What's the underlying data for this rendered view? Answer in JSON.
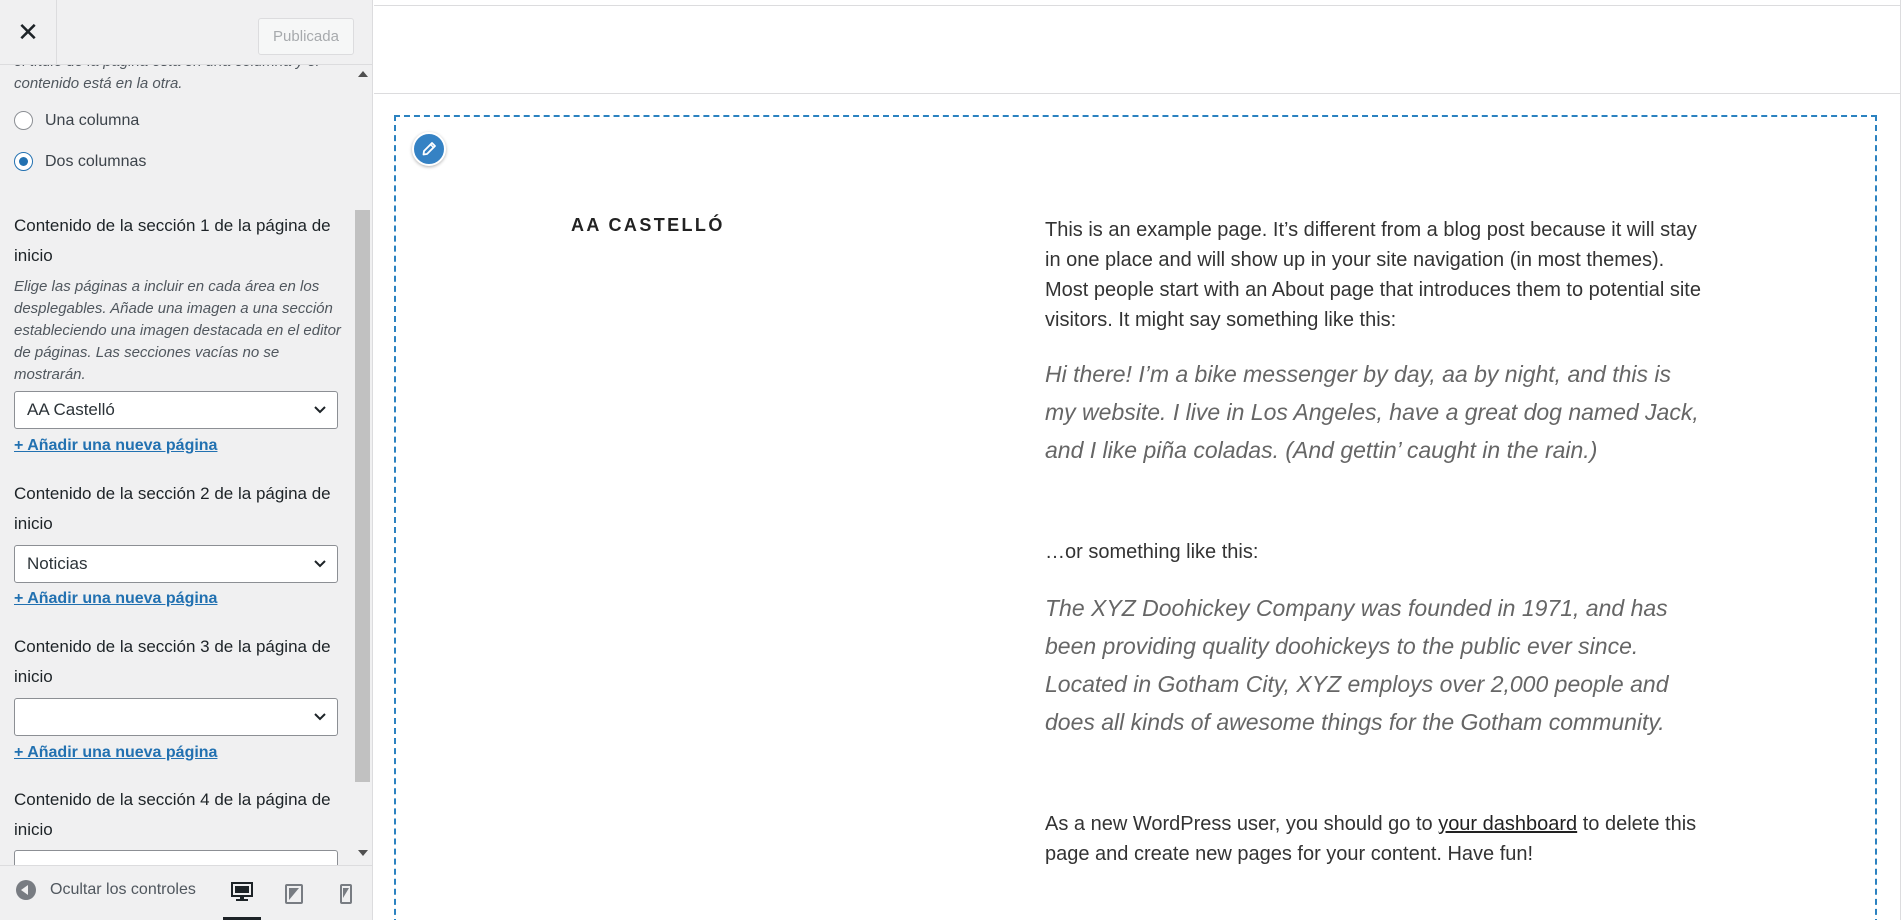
{
  "header": {
    "close_label": "✕",
    "publish_label": "Publicada"
  },
  "layout": {
    "description": "el título de la página está en una columna y el contenido está en la otra.",
    "options": [
      {
        "label": "Una columna",
        "checked": false
      },
      {
        "label": "Dos columnas",
        "checked": true
      }
    ]
  },
  "sections": [
    {
      "title": "Contenido de la sección 1 de la página de inicio",
      "description": "Elige las páginas a incluir en cada área en los desplegables. Añade una imagen a una sección estableciendo una imagen destacada en el editor de páginas. Las secciones vacías no se mostrarán.",
      "selected": "AA Castelló",
      "add_link": "+ Añadir una nueva página"
    },
    {
      "title": "Contenido de la sección 2 de la página de inicio",
      "selected": "Noticias",
      "add_link": "+ Añadir una nueva página"
    },
    {
      "title": "Contenido de la sección 3 de la página de inicio",
      "selected": "",
      "add_link": "+ Añadir una nueva página"
    },
    {
      "title": "Contenido de la sección 4 de la página de inicio"
    }
  ],
  "footer": {
    "hide_controls_label": "Ocultar los controles",
    "devices": [
      "desktop-icon",
      "tablet-icon",
      "mobile-icon"
    ],
    "active_device": "desktop"
  },
  "preview": {
    "page_title": "AA CASTELLÓ",
    "intro": "This is an example page. It’s different from a blog post because it will stay in one place and will show up in your site navigation (in most themes). Most people start with an About page that introduces them to potential site visitors. It might say something like this:",
    "quote1": "Hi there! I’m a bike messenger by day, aa by night, and this is my website. I live in Los Angeles, have a great dog named Jack, and I like piña coladas. (And gettin’ caught in the rain.)",
    "or_text": "…or something like this:",
    "quote2": "The XYZ Doohickey Company was founded in 1971, and has been providing quality doohickeys to the public ever since. Located in Gotham City, XYZ employs over 2,000 people and does all kinds of awesome things for the Gotham community.",
    "outro_before": "As a new WordPress user, you should go to ",
    "outro_link": "your dashboard",
    "outro_after": " to delete this page and create new pages for your content. Have fun!"
  },
  "colors": {
    "accent": "#2271b1",
    "frame": "#2b82c0",
    "edit_button": "#3582c4"
  }
}
